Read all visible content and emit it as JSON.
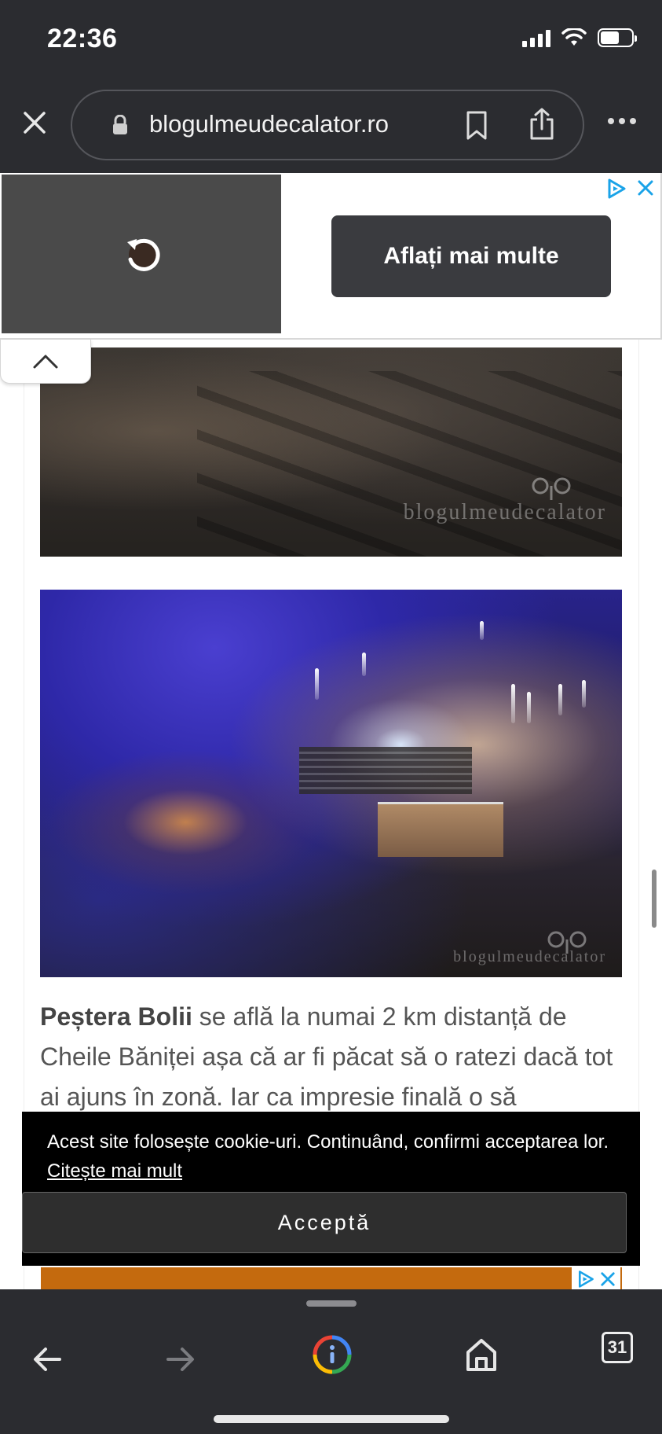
{
  "status_bar": {
    "time": "22:36",
    "battery_level": 0.6
  },
  "browser": {
    "url": "blogulmeudecalator.ro",
    "icons": {
      "close": "close-icon",
      "lock": "lock-icon",
      "bookmark": "bookmark-icon",
      "share": "share-icon",
      "more": "more-icon"
    }
  },
  "ad_banner": {
    "cta_label": "Aflați mai multe",
    "icons": {
      "replay": "replay-icon",
      "adchoices": "adchoices-icon",
      "close": "close-icon"
    }
  },
  "article": {
    "photo_watermark": "blogulmeudecalator",
    "paragraph_bold": "Peștera Bolii",
    "paragraph_rest": " se află la numai 2 km distanță de Cheile Băniței așa că ar fi păcat să o ratezi dacă tot ai ajuns în zonă. Iar ca impresie finală o să"
  },
  "cookie_banner": {
    "text": "Acest site folosește cookie-uri. Continuând, confirmi acceptarea lor.",
    "link": "Citește mai mult",
    "accept_label": "Acceptă"
  },
  "toolbar": {
    "tab_count": "31",
    "icons": {
      "back": "back-arrow-icon",
      "forward": "forward-arrow-icon",
      "lens": "google-lens-icon",
      "home": "home-icon",
      "tabs": "tabs-icon"
    }
  },
  "colors": {
    "chrome_bg": "#2b2c30",
    "ad_video_bg": "#4a4a4a",
    "ad_cta_bg": "#3a3b3f",
    "cookie_bg": "#000000",
    "adchoices": "#1aa3e8"
  }
}
